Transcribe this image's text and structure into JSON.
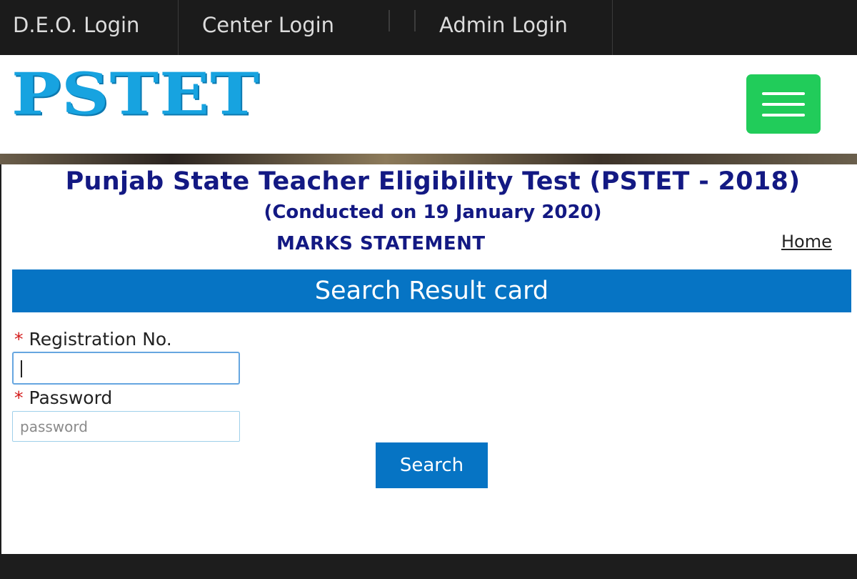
{
  "topnav": {
    "items": [
      {
        "label": "D.E.O. Login"
      },
      {
        "label": "Center Login"
      },
      {
        "label": "Admin Login"
      }
    ]
  },
  "header": {
    "logo_text": "PSTET",
    "menu_icon": "hamburger-menu-icon"
  },
  "main": {
    "title": "Punjab State Teacher Eligibility Test (PSTET - 2018)",
    "subtitle": "(Conducted on 19 January 2020)",
    "section": "MARKS STATEMENT",
    "home_link": "Home",
    "panel_title": "Search Result card"
  },
  "form": {
    "required_marker": "*",
    "registration_label": "Registration No.",
    "registration_value": "",
    "password_label": "Password",
    "password_placeholder": "password",
    "search_label": "Search"
  },
  "colors": {
    "accent_blue": "#0674c4",
    "menu_green": "#21cc5a",
    "title_navy": "#131983",
    "logo_blue": "#17a3e0"
  }
}
